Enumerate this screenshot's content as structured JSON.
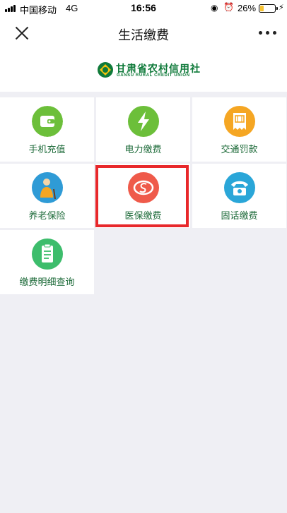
{
  "status_bar": {
    "carrier": "中国移动",
    "network": "4G",
    "time": "16:56",
    "battery_percent_label": "26%",
    "battery_level": 0.26
  },
  "nav": {
    "title": "生活缴费"
  },
  "brand": {
    "name_zh": "甘肃省农村信用社",
    "name_en": "GANSU RURAL CREDIT UNION"
  },
  "services": [
    {
      "label": "手机充值",
      "icon": "wallet-icon",
      "color": "#6cbf3a"
    },
    {
      "label": "电力缴费",
      "icon": "lightning-icon",
      "color": "#6cbf3a"
    },
    {
      "label": "交通罚款",
      "icon": "ticket-icon",
      "color": "#f5a623"
    },
    {
      "label": "养老保险",
      "icon": "elderly-person-icon",
      "color": "#2f9bd6"
    },
    {
      "label": "医保缴费",
      "icon": "social-insurance-icon",
      "color": "#ef5a4a"
    },
    {
      "label": "固话缴费",
      "icon": "telephone-icon",
      "color": "#2aa6d8"
    },
    {
      "label": "缴费明细查询",
      "icon": "document-list-icon",
      "color": "#3dbd6c"
    }
  ],
  "colors": {
    "label_green": "#1e6b3a",
    "highlight_red": "#e8282b",
    "background": "#efeff4"
  }
}
